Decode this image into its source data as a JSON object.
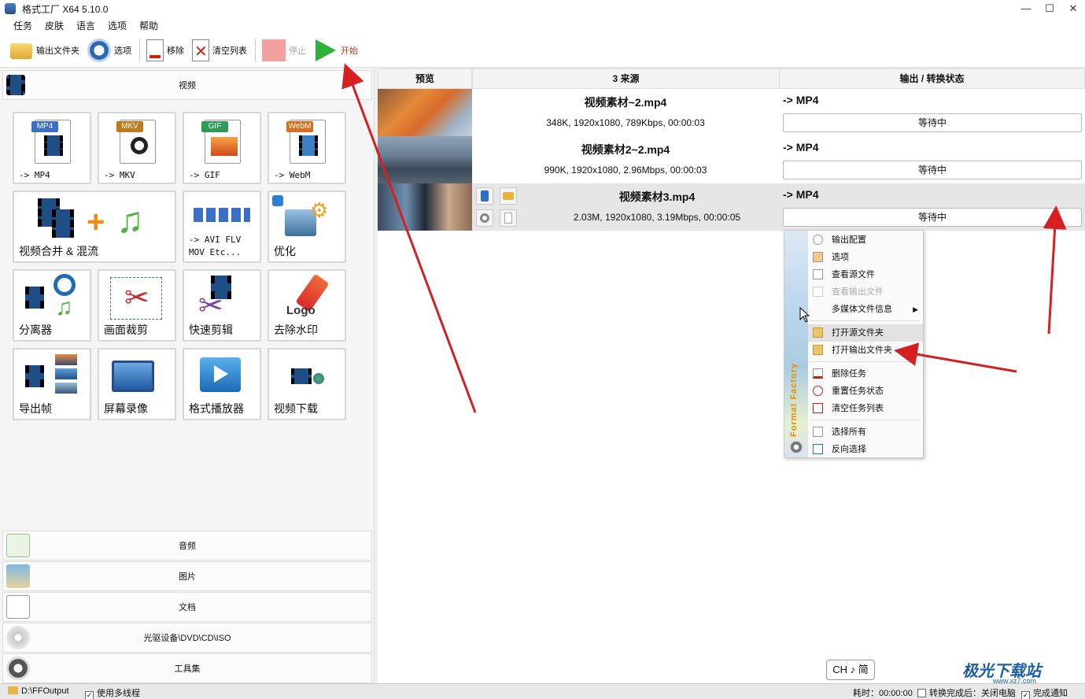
{
  "window": {
    "title": "格式工厂 X64 5.10.0",
    "minimize": "—",
    "maximize": "☐",
    "close": "✕"
  },
  "menu": [
    "任务",
    "皮肤",
    "语言",
    "选项",
    "帮助"
  ],
  "toolbar": {
    "output_folder": "输出文件夹",
    "options": "选项",
    "remove": "移除",
    "clear_list": "清空列表",
    "stop": "停止",
    "start": "开始"
  },
  "categories": {
    "video": "视频",
    "audio": "音频",
    "image": "图片",
    "document": "文档",
    "disc": "光驱设备\\DVD\\CD\\ISO",
    "tools": "工具集"
  },
  "video_tiles": [
    {
      "label": "-> MP4",
      "badge": "MP4"
    },
    {
      "label": "-> MKV",
      "badge": "MKV"
    },
    {
      "label": "-> GIF",
      "badge": "GIF"
    },
    {
      "label": "-> WebM",
      "badge": "WebM"
    },
    {
      "label": "视频合并 & 混流"
    },
    {
      "label": "-> AVI FLV\nMOV Etc..."
    },
    {
      "label": "优化"
    },
    {
      "label": "分离器"
    },
    {
      "label": "画面裁剪"
    },
    {
      "label": "快速剪辑"
    },
    {
      "label": "去除水印"
    },
    {
      "label": "导出帧"
    },
    {
      "label": "屏幕录像"
    },
    {
      "label": "格式播放器"
    },
    {
      "label": "视频下载"
    }
  ],
  "logo_text": "Logo",
  "task_list": {
    "headers": {
      "preview": "预览",
      "source": "3 来源",
      "output": "输出 / 转换状态"
    },
    "rows": [
      {
        "name": "视频素材~2.mp4",
        "info": "348K, 1920x1080, 789Kbps, 00:00:03",
        "output": "-> MP4",
        "status": "等待中"
      },
      {
        "name": "视频素材2~2.mp4",
        "info": "990K, 1920x1080, 2.96Mbps, 00:00:03",
        "output": "-> MP4",
        "status": "等待中"
      },
      {
        "name": "视频素材3.mp4",
        "info": "2.03M, 1920x1080, 3.19Mbps, 00:00:05",
        "output": "-> MP4",
        "status": "等待中"
      }
    ]
  },
  "context_menu": {
    "brand": "Format Factory",
    "items": [
      "输出配置",
      "选项",
      "查看源文件",
      "查看输出文件",
      "多媒体文件信息",
      "打开源文件夹",
      "打开输出文件夹",
      "删除任务",
      "重置任务状态",
      "清空任务列表",
      "选择所有",
      "反向选择"
    ]
  },
  "ime": "CH ♪ 简",
  "watermark": {
    "main": "极光下载站",
    "sub": "www.xz7.com"
  },
  "statusbar": {
    "output_path": "D:\\FFOutput",
    "multithread": "使用多线程",
    "elapsed": "耗时：00:00:00",
    "after_convert": "转换完成后：关闭电脑",
    "notify": "完成通知"
  }
}
